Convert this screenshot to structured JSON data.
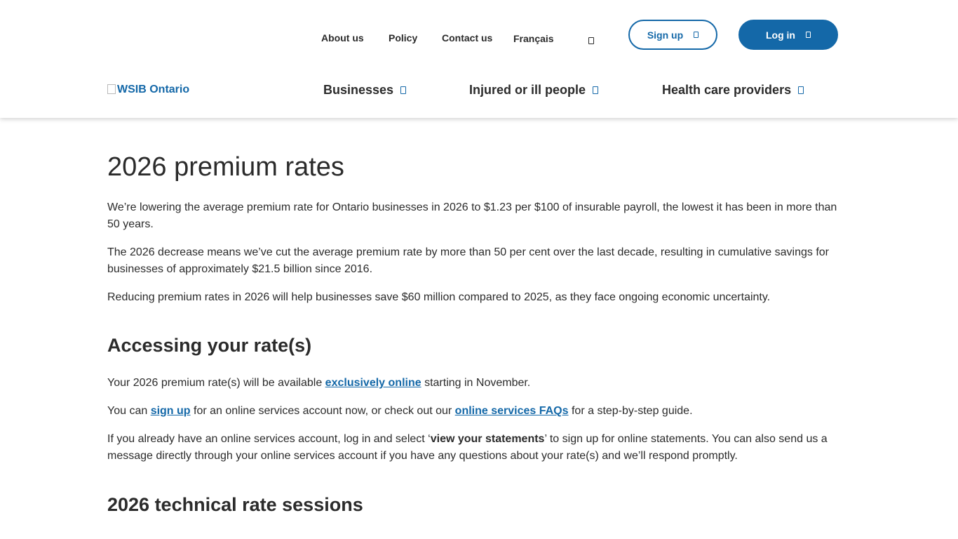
{
  "header": {
    "utility_links": {
      "about": "About us",
      "policy": "Policy",
      "contact": "Contact us",
      "language": "Français"
    },
    "search_icon": "search-icon",
    "signup_label": "Sign up",
    "login_label": "Log in",
    "logo_text": "WSIB Ontario",
    "main_nav": {
      "businesses": "Businesses",
      "injured": "Injured or ill people",
      "providers": "Health care providers"
    }
  },
  "main": {
    "title": "2026 premium rates",
    "intro": [
      "We’re lowering the average premium rate for Ontario businesses in 2026 to $1.23 per $100 of insurable payroll, the lowest it has been in more than 50 years.",
      "The 2026 decrease means we’ve cut the average premium rate by more than 50 per cent over the last decade, resulting in cumulative savings for businesses of approximately $21.5 billion since 2016.",
      "Reducing premium rates in 2026 will help businesses save $60 million compared to 2025, as they face ongoing economic uncertainty."
    ],
    "accessing": {
      "heading": "Accessing your rate(s)",
      "p1": {
        "before": "Your 2026 premium rate(s) will be available ",
        "link": "exclusively online",
        "after": " starting in November."
      },
      "p2": {
        "before": "You can ",
        "link1": "sign up",
        "middle": " for an online services account now, or check out our ",
        "link2": "online services FAQs",
        "after": " for a step-by-step guide."
      },
      "p3": {
        "before": "If you already have an online services account, log in and select ‘",
        "bold": "view your statements",
        "after": "’ to sign up for online statements. You can also send us a message directly through your online services account if you have any questions about your rate(s) and we’ll respond promptly."
      }
    },
    "sessions": {
      "heading": "2026 technical rate sessions"
    }
  },
  "colors": {
    "brand_blue": "#1468a8",
    "text": "#2b2b2b"
  }
}
